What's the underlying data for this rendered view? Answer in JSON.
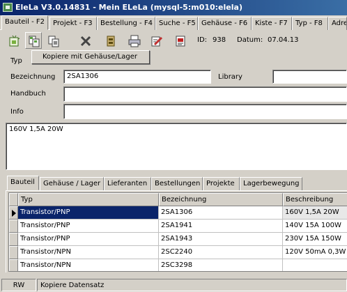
{
  "window": {
    "title": "EleLa V3.0.14831  - Mein ELeLa (mysql-5:m010:elela)"
  },
  "main_tabs": [
    {
      "label": "Bauteil - F2",
      "active": true
    },
    {
      "label": "Projekt - F3"
    },
    {
      "label": "Bestellung - F4"
    },
    {
      "label": "Suche - F5"
    },
    {
      "label": "Gehäuse - F6"
    },
    {
      "label": "Kiste - F7"
    },
    {
      "label": "Typ - F8"
    },
    {
      "label": "Adre"
    }
  ],
  "toolbar": {
    "id_label": "ID:",
    "id_value": "938",
    "date_label": "Datum:",
    "date_value": "07.04.13",
    "buttons": [
      "new-icon",
      "copy-icon",
      "copy-with-housing-icon",
      "delete-icon",
      "storage-icon",
      "print-icon",
      "edit-icon",
      "datasheet-icon"
    ]
  },
  "dropdown": {
    "item": "Kopiere mit Gehäuse/Lager"
  },
  "form": {
    "typ_label": "Typ",
    "bezeichnung_label": "Bezeichnung",
    "bezeichnung_value": "2SA1306",
    "library_label": "Library",
    "library_value": "",
    "handbuch_label": "Handbuch",
    "handbuch_value": "",
    "info_label": "Info",
    "info_value": "",
    "memo": "160V 1,5A 20W"
  },
  "sub_tabs": [
    {
      "label": "Bauteil",
      "active": true
    },
    {
      "label": "Gehäuse / Lager"
    },
    {
      "label": "Lieferanten"
    },
    {
      "label": "Bestellungen"
    },
    {
      "label": "Projekte"
    },
    {
      "label": "Lagerbewegung"
    }
  ],
  "grid": {
    "columns": [
      "Typ",
      "Bezeichnung",
      "Beschreibung"
    ],
    "rows": [
      [
        "Transistor/PNP",
        "2SA1306",
        "160V 1,5A 20W"
      ],
      [
        "Transistor/PNP",
        "2SA1941",
        "140V 15A 100W"
      ],
      [
        "Transistor/PNP",
        "2SA1943",
        "230V 15A 150W"
      ],
      [
        "Transistor/NPN",
        "2SC2240",
        "120V 50mA 0,3W"
      ],
      [
        "Transistor/NPN",
        "2SC3298",
        ""
      ]
    ],
    "selected_row": 0
  },
  "status": {
    "mode": "RW",
    "message": "Kopiere Datensatz"
  },
  "colors": {
    "title_start": "#0a246a",
    "title_end": "#3a6ea5",
    "selection": "#0a246a",
    "face": "#d4d0c8"
  }
}
